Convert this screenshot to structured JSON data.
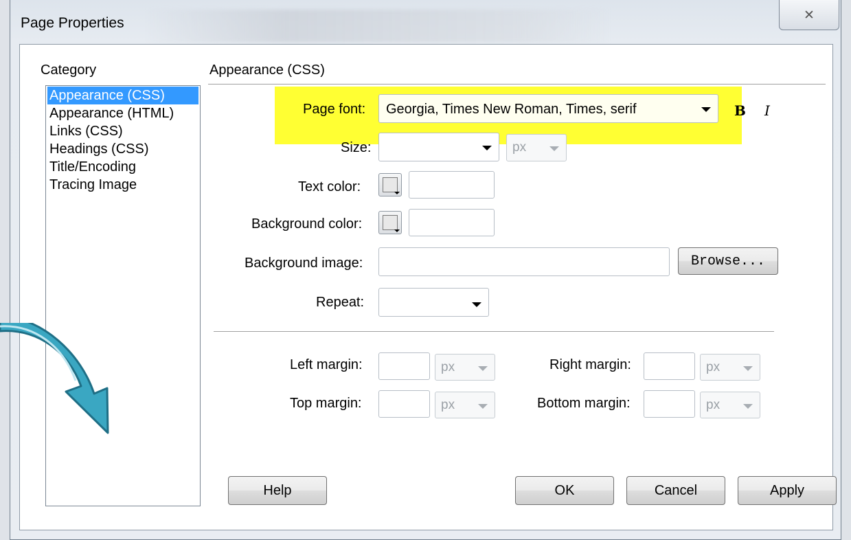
{
  "window": {
    "title": "Page Properties",
    "close_glyph": "✕"
  },
  "category": {
    "label": "Category",
    "items": [
      {
        "label": "Appearance (CSS)",
        "selected": true
      },
      {
        "label": "Appearance (HTML)"
      },
      {
        "label": "Links (CSS)"
      },
      {
        "label": "Headings (CSS)"
      },
      {
        "label": "Title/Encoding"
      },
      {
        "label": "Tracing Image"
      }
    ]
  },
  "section_title": "Appearance (CSS)",
  "form": {
    "page_font_label": "Page font:",
    "page_font_value": "Georgia, Times New Roman, Times, serif",
    "bold_glyph": "B",
    "italic_glyph": "I",
    "size_label": "Size:",
    "size_value": "",
    "size_unit": "px",
    "text_color_label": "Text color:",
    "text_color_value": "",
    "bg_color_label": "Background color:",
    "bg_color_value": "",
    "bg_image_label": "Background image:",
    "bg_image_value": "",
    "browse_label": "Browse...",
    "repeat_label": "Repeat:",
    "repeat_value": ""
  },
  "margins": {
    "left_label": "Left margin:",
    "left_unit": "px",
    "right_label": "Right margin:",
    "right_unit": "px",
    "top_label": "Top margin:",
    "top_unit": "px",
    "bottom_label": "Bottom margin:",
    "bottom_unit": "px"
  },
  "buttons": {
    "help": "Help",
    "ok": "OK",
    "cancel": "Cancel",
    "apply": "Apply"
  },
  "colors": {
    "highlight": "#ffff33",
    "selection": "#3399ff",
    "annotation_arrow": "#3aa7c2"
  },
  "annotation": {
    "icon": "curved-arrow-icon"
  }
}
